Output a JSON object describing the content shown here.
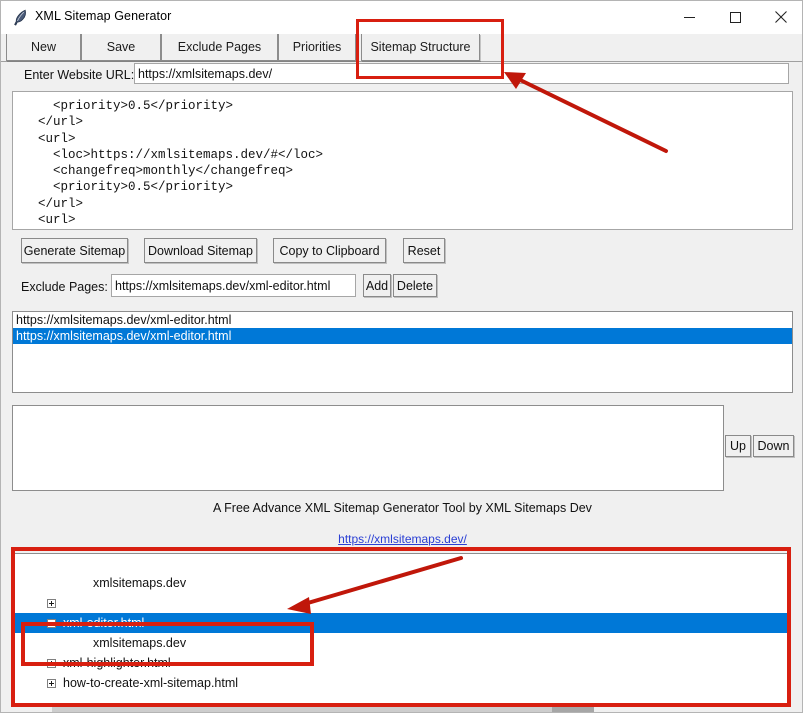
{
  "window": {
    "title": "XML Sitemap Generator",
    "icon": "feather-quill-icon",
    "minimize_label": "Minimize",
    "maximize_label": "Maximize",
    "close_label": "Close"
  },
  "tabs": [
    {
      "label": "New",
      "name": "tab-new"
    },
    {
      "label": "Save",
      "name": "tab-save"
    },
    {
      "label": "Exclude Pages",
      "name": "tab-exclude-pages"
    },
    {
      "label": "Priorities",
      "name": "tab-priorities"
    },
    {
      "label": "Sitemap Structure",
      "name": "tab-sitemap-structure"
    }
  ],
  "url_row": {
    "label": "Enter Website URL:",
    "value": "https://xmlsitemaps.dev/",
    "placeholder": "https://"
  },
  "xml_output": {
    "text": "    <priority>0.5</priority>\n  </url>\n  <url>\n    <loc>https://xmlsitemaps.dev/#</loc>\n    <changefreq>monthly</changefreq>\n    <priority>0.5</priority>\n  </url>\n  <url>"
  },
  "actions": {
    "generate": "Generate Sitemap",
    "download": "Download Sitemap",
    "copy": "Copy to Clipboard",
    "reset": "Reset"
  },
  "exclude_row": {
    "label": "Exclude Pages:",
    "value": "https://xmlsitemaps.dev/xml-editor.html",
    "placeholder": "https://",
    "add_label": "Add",
    "delete_label": "Delete"
  },
  "exclude_list": {
    "items": [
      {
        "text": "https://xmlsitemaps.dev/xml-editor.html",
        "selected": false
      },
      {
        "text": "https://xmlsitemaps.dev/xml-editor.html",
        "selected": true
      }
    ]
  },
  "order_panel": {
    "up_label": "Up",
    "down_label": "Down",
    "items": []
  },
  "footer": {
    "note": "A Free Advance XML Sitemap Generator Tool by XML Sitemaps Dev",
    "link": "https://xmlsitemaps.dev/"
  },
  "tree": {
    "rows": [
      {
        "label": "xmlsitemaps.dev",
        "indent": 62,
        "expander": "none",
        "selected": false
      },
      {
        "label": "",
        "indent": 32,
        "expander": "plus",
        "selected": false
      },
      {
        "label": "xml-editor.html",
        "indent": 32,
        "expander": "minus",
        "selected": true
      },
      {
        "label": "xmlsitemaps.dev",
        "indent": 62,
        "expander": "none",
        "selected": false
      },
      {
        "label": "xml-highlighter.html",
        "indent": 32,
        "expander": "plus",
        "selected": false
      },
      {
        "label": "how-to-create-xml-sitemap.html",
        "indent": 32,
        "expander": "plus",
        "selected": false
      }
    ]
  },
  "annotations": {
    "color": "#d81f10",
    "box_tab_label": "highlight-sitemap-structure-tab",
    "box_tree_label": "highlight-tree-panel",
    "box_tree_item_label": "highlight-selected-tree-node",
    "arrow_top_label": "arrow-to-sitemap-structure-tab",
    "arrow_bottom_label": "arrow-to-selected-tree-node"
  },
  "colors": {
    "selection_blue": "#0078d7",
    "annotation_red": "#d81f10",
    "link_blue": "#2a3fd4",
    "window_chrome": "#f0f0f0"
  }
}
